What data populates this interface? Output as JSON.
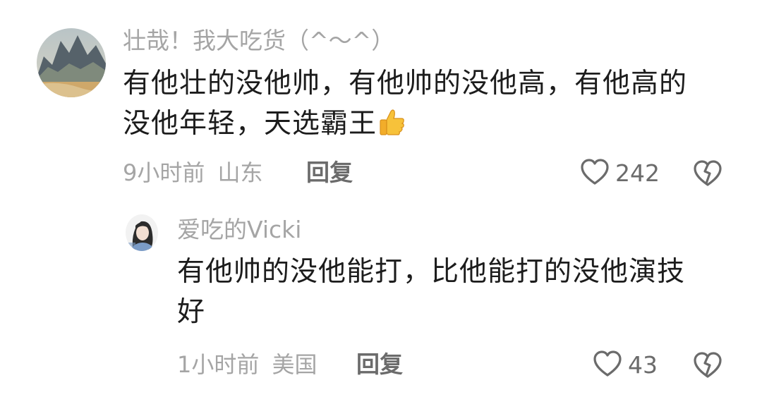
{
  "comments": [
    {
      "username": "壮哉！我大吃货（^～^）",
      "text_line1": "有他壮的没他帅，有他帅的没他高，有他高的",
      "text_line2": "没他年轻，天选霸王",
      "emoji": "thumbs-up-icon",
      "time": "9小时前",
      "location": "山东",
      "reply_label": "回复",
      "likes": "242"
    },
    {
      "username": "爱吃的Vicki",
      "text_line1": "有他帅的没他能打，比他能打的没他演技",
      "text_line2": "好",
      "time": "1小时前",
      "location": "美国",
      "reply_label": "回复",
      "likes": "43"
    }
  ],
  "colors": {
    "username": "#a5a5a5",
    "text": "#1c1c1c",
    "meta": "#a5a5a5",
    "icon": "#6b6b6b"
  }
}
